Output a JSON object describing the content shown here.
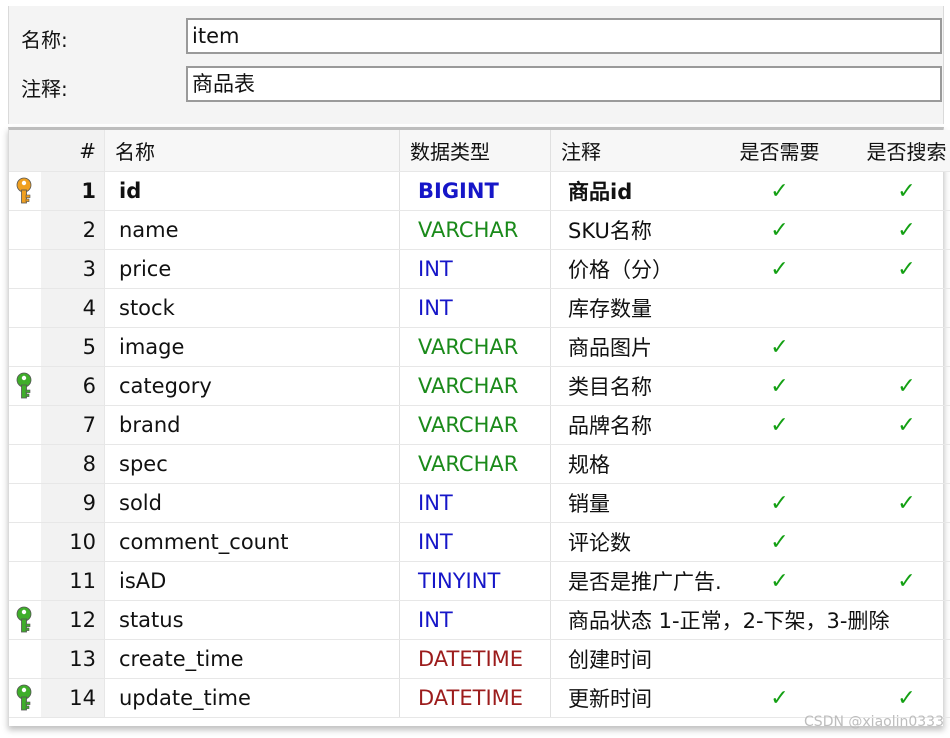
{
  "form": {
    "name_label": "名称:",
    "name_value": "item",
    "comment_label": "注释:",
    "comment_value": "商品表"
  },
  "table": {
    "headers": {
      "num": "#",
      "name": "名称",
      "type": "数据类型",
      "comment": "注释",
      "required": "是否需要",
      "searchable": "是否搜索"
    },
    "rows": [
      {
        "key": "primary",
        "num": "1",
        "name": "id",
        "type": "BIGINT",
        "comment": "商品id",
        "required": "✓",
        "searchable": "✓",
        "bold": true
      },
      {
        "key": "",
        "num": "2",
        "name": "name",
        "type": "VARCHAR",
        "comment": "SKU名称",
        "required": "✓",
        "searchable": "✓"
      },
      {
        "key": "",
        "num": "3",
        "name": "price",
        "type": "INT",
        "comment": "价格（分）",
        "required": "✓",
        "searchable": "✓"
      },
      {
        "key": "",
        "num": "4",
        "name": "stock",
        "type": "INT",
        "comment": "库存数量",
        "required": "",
        "searchable": ""
      },
      {
        "key": "",
        "num": "5",
        "name": "image",
        "type": "VARCHAR",
        "comment": "商品图片",
        "required": "✓",
        "searchable": ""
      },
      {
        "key": "index",
        "num": "6",
        "name": "category",
        "type": "VARCHAR",
        "comment": "类目名称",
        "required": "✓",
        "searchable": "✓"
      },
      {
        "key": "",
        "num": "7",
        "name": "brand",
        "type": "VARCHAR",
        "comment": "品牌名称",
        "required": "✓",
        "searchable": "✓"
      },
      {
        "key": "",
        "num": "8",
        "name": "spec",
        "type": "VARCHAR",
        "comment": "规格",
        "required": "",
        "searchable": ""
      },
      {
        "key": "",
        "num": "9",
        "name": "sold",
        "type": "INT",
        "comment": "销量",
        "required": "✓",
        "searchable": "✓"
      },
      {
        "key": "",
        "num": "10",
        "name": "comment_count",
        "type": "INT",
        "comment": "评论数",
        "required": "✓",
        "searchable": ""
      },
      {
        "key": "",
        "num": "11",
        "name": "isAD",
        "type": "TINYINT",
        "comment": "是否是推广广告.",
        "required": "✓",
        "searchable": "✓"
      },
      {
        "key": "index",
        "num": "12",
        "name": "status",
        "type": "INT",
        "comment": "商品状态 1-正常，2-下架，3-删除",
        "required": "",
        "searchable": ""
      },
      {
        "key": "",
        "num": "13",
        "name": "create_time",
        "type": "DATETIME",
        "comment": "创建时间",
        "required": "",
        "searchable": ""
      },
      {
        "key": "index",
        "num": "14",
        "name": "update_time",
        "type": "DATETIME",
        "comment": "更新时间",
        "required": "✓",
        "searchable": "✓"
      }
    ]
  },
  "watermark": "CSDN @xiaolin0333",
  "colors": {
    "primary_key": "#f0a020",
    "index_key": "#3fae2a",
    "check": "#14a014",
    "int_type": "#1616c8",
    "varchar_type": "#1a8a1a",
    "datetime_type": "#9c1c1c"
  },
  "icons": {
    "primary": "primary-key-icon",
    "index": "index-key-icon"
  }
}
